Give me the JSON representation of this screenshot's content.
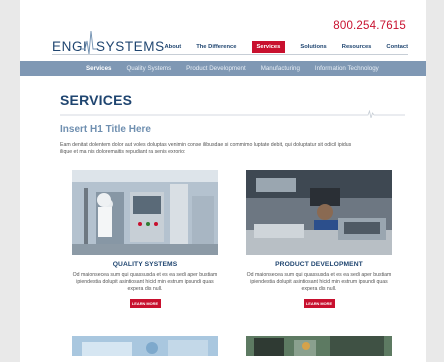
{
  "header": {
    "phone": "800.254.7615",
    "logo_left": "ENGI",
    "logo_right": "SYSTEMS"
  },
  "main_nav": [
    {
      "label": "About",
      "active": false
    },
    {
      "label": "The Difference",
      "active": false
    },
    {
      "label": "Services",
      "active": true
    },
    {
      "label": "Solutions",
      "active": false
    },
    {
      "label": "Resources",
      "active": false
    },
    {
      "label": "Contact",
      "active": false
    }
  ],
  "sub_nav": [
    {
      "label": "Services",
      "active": true
    },
    {
      "label": "Quality Systems",
      "active": false
    },
    {
      "label": "Product Development",
      "active": false
    },
    {
      "label": "Manufacturing",
      "active": false
    },
    {
      "label": "Information Technology",
      "active": false
    }
  ],
  "content": {
    "page_title": "SERVICES",
    "h1_placeholder": "Insert H1 Title Here",
    "intro": "Eam denitat dolentem dolor aut voles doluptas venimin conse ilibusdae si commimo luptate debit, qui doluptatur sit odicil ipidus ilique et ma nis doloremaitis repudiant ra senis exrorio:"
  },
  "cards": [
    {
      "title": "QUALITY SYSTEMS",
      "body": "Od maionsecea sum qui quassusda et es ea sedi aper bustiam ipiendestia dolupit asintiosant hicid min estrum ipsundi quas expera dis null.",
      "button": "LEARN MORE"
    },
    {
      "title": "PRODUCT DEVELOPMENT",
      "body": "Od maionsecea sum qui quassusda et es ea sedi aper bustiam ipiendestia dolupit asintiosant hicid min estrum ipsundi quas expera dis null.",
      "button": "LEARN MORE"
    }
  ],
  "colors": {
    "brand_red": "#c8102e",
    "brand_navy": "#1f4570",
    "subnav_blue": "#7f98b4",
    "light_blue": "#6f8fb0"
  }
}
